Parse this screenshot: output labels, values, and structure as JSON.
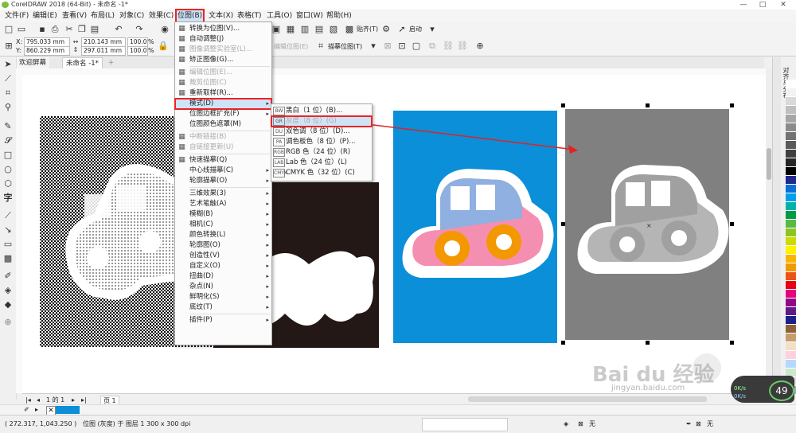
{
  "window": {
    "title": "CorelDRAW 2018 (64-Bit) - 未命名 -1*",
    "min": "—",
    "max": "□",
    "close": "✕"
  },
  "menubar": [
    "文件(F)",
    "编辑(E)",
    "查看(V)",
    "布局(L)",
    "对象(C)",
    "效果(C)",
    "位图(B)",
    "文本(X)",
    "表格(T)",
    "工具(O)",
    "窗口(W)",
    "帮助(H)"
  ],
  "toolbar1": {
    "snap": "贴齐(T)",
    "launch": "启动"
  },
  "propbar": {
    "x": "795.033 mm",
    "y": "860.229 mm",
    "w": "210.143 mm",
    "h": "297.011 mm",
    "sx": "100.0",
    "sy": "100.0",
    "pct": "%",
    "x_label": "X:",
    "y_label": "Y:",
    "trace": "描摹位图(T)",
    "edit_bitmap": "编辑位图(E)"
  },
  "tabs": {
    "welcome": "欢迎屏幕",
    "doc": "未命名 -1*",
    "add": "+"
  },
  "bitmap_menu": [
    {
      "label": "转换为位图(V)...",
      "icon": "convert-bitmap-icon"
    },
    {
      "label": "自动调整(J)",
      "icon": "auto-adjust-icon"
    },
    {
      "label": "图像调整实验室(L)...",
      "icon": "image-adjust-icon",
      "disabled": true
    },
    {
      "label": "矫正图像(G)...",
      "icon": "straighten-icon"
    },
    {
      "sep": true
    },
    {
      "label": "编辑位图(E)...",
      "icon": "edit-bitmap-icon",
      "disabled": true
    },
    {
      "label": "裁剪位图(C)",
      "icon": "crop-bitmap-icon",
      "disabled": true
    },
    {
      "label": "重新取样(R)...",
      "icon": "resample-icon"
    },
    {
      "label": "模式(D)",
      "icon": "",
      "submenu": true,
      "highlight": true
    },
    {
      "label": "位图边框扩充(F)",
      "icon": "",
      "submenu": true
    },
    {
      "label": "位图颜色遮罩(M)",
      "icon": ""
    },
    {
      "sep": true
    },
    {
      "label": "中断链接(B)",
      "icon": "break-link-icon",
      "disabled": true
    },
    {
      "label": "自链接更新(U)",
      "icon": "update-link-icon",
      "disabled": true
    },
    {
      "sep": true
    },
    {
      "label": "快速描摹(Q)",
      "icon": "quick-trace-icon"
    },
    {
      "label": "中心线描摹(C)",
      "icon": "",
      "submenu": true
    },
    {
      "label": "轮廓描摹(O)",
      "icon": "",
      "submenu": true
    },
    {
      "sep": true
    },
    {
      "label": "三维效果(3)",
      "icon": "",
      "submenu": true
    },
    {
      "label": "艺术笔触(A)",
      "icon": "",
      "submenu": true
    },
    {
      "label": "模糊(B)",
      "icon": "",
      "submenu": true
    },
    {
      "label": "相机(C)",
      "icon": "",
      "submenu": true
    },
    {
      "label": "颜色转换(L)",
      "icon": "",
      "submenu": true
    },
    {
      "label": "轮廓图(O)",
      "icon": "",
      "submenu": true
    },
    {
      "label": "创造性(V)",
      "icon": "",
      "submenu": true
    },
    {
      "label": "自定义(O)",
      "icon": "",
      "submenu": true
    },
    {
      "label": "扭曲(D)",
      "icon": "",
      "submenu": true
    },
    {
      "label": "杂点(N)",
      "icon": "",
      "submenu": true
    },
    {
      "label": "鲜明化(S)",
      "icon": "",
      "submenu": true
    },
    {
      "label": "底纹(T)",
      "icon": "",
      "submenu": true
    },
    {
      "sep": true
    },
    {
      "label": "插件(P)",
      "icon": "",
      "submenu": true
    }
  ],
  "mode_menu": [
    {
      "label": "黑白（1 位）(B)...",
      "icon": "BW",
      "disabled": false
    },
    {
      "label": "灰度（8 位）(G)",
      "icon": "GR",
      "disabled": true,
      "highlight": true
    },
    {
      "label": "双色调（8 位）(D)...",
      "icon": "DU",
      "disabled": false
    },
    {
      "label": "调色板色（8 位）(P)...",
      "icon": "PA",
      "disabled": false
    },
    {
      "label": "RGB 色（24 位）(R)",
      "icon": "RGB",
      "disabled": false
    },
    {
      "label": "Lab 色（24 位）(L)",
      "icon": "LAB",
      "disabled": false
    },
    {
      "label": "CMYK 色（32 位）(C)",
      "icon": "CMYK",
      "disabled": false
    }
  ],
  "page_nav": {
    "page_of": "1 的 1",
    "page_tab": "页 1"
  },
  "status": {
    "coords": "( 272.317, 1,043.250 )",
    "info": "位图 (灰度) 于 图层 1 300 x 300 dpi",
    "fill_none": "无",
    "outline_none": "无"
  },
  "docker_title": "对齐与分布",
  "overlay": {
    "percent": "49",
    "pct_sign": "%",
    "up": "0K/s",
    "down": "0K/s"
  },
  "watermark": {
    "brand": "Bai du 经验",
    "url": "jingyan.baidu.com"
  },
  "palette": [
    "#ffffff",
    "#f2f2f2",
    "#d9d9d9",
    "#bfbfbf",
    "#a6a6a6",
    "#8c8c8c",
    "#737373",
    "#595959",
    "#404040",
    "#262626",
    "#000000",
    "#1f2a8c",
    "#0b6fd6",
    "#00a0e9",
    "#00b2a9",
    "#009944",
    "#58b947",
    "#8fc31f",
    "#cfdb00",
    "#fff100",
    "#f8b500",
    "#f39800",
    "#ea5514",
    "#e60012",
    "#e4007f",
    "#920783",
    "#601986",
    "#1d2088",
    "#8c6239",
    "#c69c6d",
    "#f0e0c8",
    "#ffd0e0",
    "#b3d9ff",
    "#cce8cc",
    "#dcdcdc",
    "#aaaaaa"
  ],
  "colors": {
    "accent": "#e22222",
    "hl": "#cfe3f7",
    "blue_card": "#0a8fd8",
    "gray_card": "#808080"
  }
}
